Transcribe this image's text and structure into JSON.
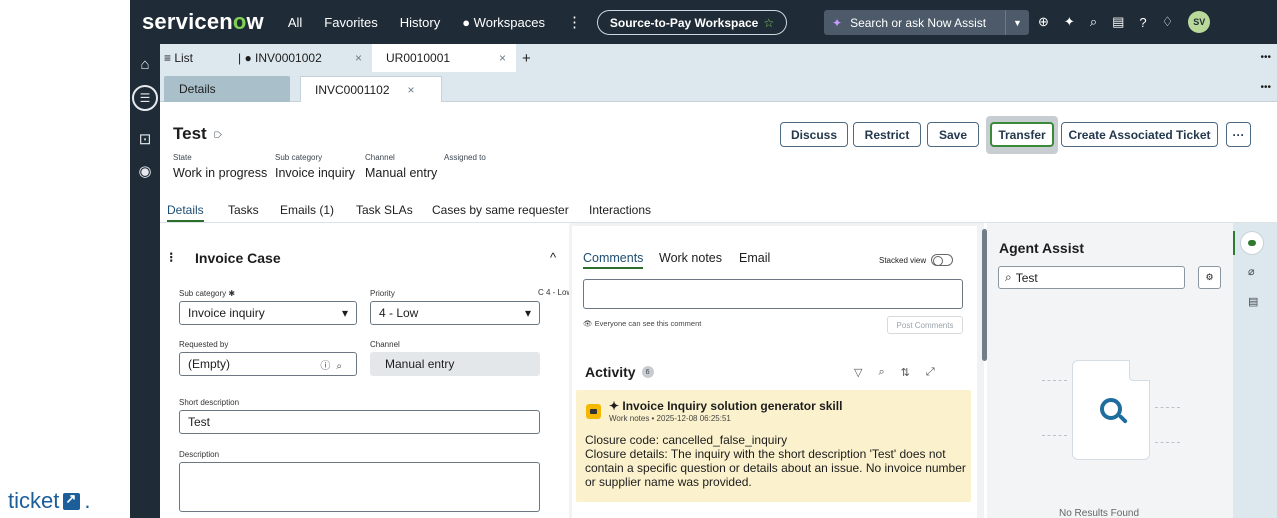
{
  "outer": {
    "ticket_text": "ticket",
    "suffix": "."
  },
  "topnav": {
    "logo_before": "servicen",
    "logo_o": "o",
    "logo_after": "w",
    "links": [
      "All",
      "Favorites",
      "History",
      "● Workspaces"
    ],
    "workspace": "Source-to-Pay Workspace",
    "workspace_star": "☆",
    "search_placeholder": "Search or ask Now Assist",
    "avatar": "SV"
  },
  "tabstrip": {
    "list_label": "≡ List",
    "tabs": [
      {
        "label": "| ● INV0001002",
        "close": "×"
      },
      {
        "label": "UR0010001",
        "close": "×"
      }
    ],
    "add": "+",
    "more": "•••"
  },
  "subtabs": {
    "details": "Details",
    "record": "INVC0001102",
    "close": "×",
    "more": "•••"
  },
  "record": {
    "title": "Test",
    "fields": [
      {
        "label": "State",
        "value": "Work in progress"
      },
      {
        "label": "Sub category",
        "value": "Invoice inquiry"
      },
      {
        "label": "Channel",
        "value": "Manual entry"
      },
      {
        "label": "Assigned to",
        "value": ""
      }
    ],
    "buttons": {
      "discuss": "Discuss",
      "restrict": "Restrict",
      "save": "Save",
      "transfer": "Transfer",
      "create": "Create Associated Ticket",
      "more": "···"
    }
  },
  "content_tabs": [
    "Details",
    "Tasks",
    "Emails (1)",
    "Task SLAs",
    "Cases by same requester",
    "Interactions"
  ],
  "form": {
    "section_title": "Invoice Case",
    "sub_category_label": "Sub category ✱",
    "sub_category_value": "Invoice inquiry",
    "priority_label": "Priority",
    "priority_badge": "C 4 - Low",
    "priority_value": "4 - Low",
    "requested_by_label": "Requested by",
    "requested_by_value": "(Empty)",
    "channel_label": "Channel",
    "channel_value": "Manual entry",
    "short_desc_label": "Short description",
    "short_desc_value": "Test",
    "description_label": "Description"
  },
  "comments": {
    "tabs": [
      "Comments",
      "Work notes",
      "Email"
    ],
    "stacked_view": "Stacked view",
    "everyone_note": "Everyone can see this comment",
    "post_button": "Post Comments"
  },
  "activity": {
    "title": "Activity",
    "count": "6",
    "entry": {
      "title": "✦ Invoice Inquiry solution generator skill",
      "meta": "Work notes • 2025-12-08 06:25:51",
      "line1": "Closure code: cancelled_false_inquiry",
      "line2": "Closure details: The inquiry with the short description 'Test' does not contain a specific question or details about an issue. No invoice number or supplier name was provided."
    }
  },
  "agent_assist": {
    "title": "Agent Assist",
    "search_value": "Test",
    "bottom_text": "No Results Found"
  },
  "colors": {
    "nav_bg": "#1f2b36",
    "accent_green": "#2b6d2b",
    "strip_bg": "#dde8ee",
    "activity_card": "#fbf2cd"
  }
}
